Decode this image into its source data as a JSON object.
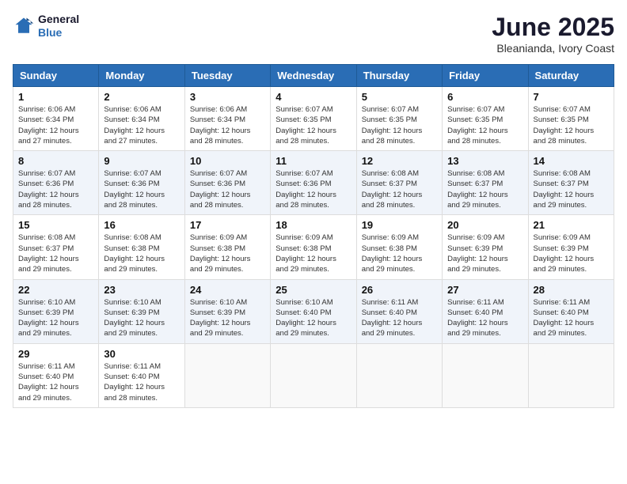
{
  "header": {
    "logo_line1": "General",
    "logo_line2": "Blue",
    "main_title": "June 2025",
    "subtitle": "Bleanianda, Ivory Coast"
  },
  "calendar": {
    "days_of_week": [
      "Sunday",
      "Monday",
      "Tuesday",
      "Wednesday",
      "Thursday",
      "Friday",
      "Saturday"
    ],
    "weeks": [
      [
        null,
        {
          "day": "2",
          "sunrise": "6:06 AM",
          "sunset": "6:34 PM",
          "daylight": "12 hours and 27 minutes."
        },
        {
          "day": "3",
          "sunrise": "6:06 AM",
          "sunset": "6:34 PM",
          "daylight": "12 hours and 28 minutes."
        },
        {
          "day": "4",
          "sunrise": "6:07 AM",
          "sunset": "6:35 PM",
          "daylight": "12 hours and 28 minutes."
        },
        {
          "day": "5",
          "sunrise": "6:07 AM",
          "sunset": "6:35 PM",
          "daylight": "12 hours and 28 minutes."
        },
        {
          "day": "6",
          "sunrise": "6:07 AM",
          "sunset": "6:35 PM",
          "daylight": "12 hours and 28 minutes."
        },
        {
          "day": "7",
          "sunrise": "6:07 AM",
          "sunset": "6:35 PM",
          "daylight": "12 hours and 28 minutes."
        }
      ],
      [
        {
          "day": "1",
          "sunrise": "6:06 AM",
          "sunset": "6:34 PM",
          "daylight": "12 hours and 27 minutes."
        },
        null,
        null,
        null,
        null,
        null,
        null
      ],
      [
        {
          "day": "8",
          "sunrise": "6:07 AM",
          "sunset": "6:36 PM",
          "daylight": "12 hours and 28 minutes."
        },
        {
          "day": "9",
          "sunrise": "6:07 AM",
          "sunset": "6:36 PM",
          "daylight": "12 hours and 28 minutes."
        },
        {
          "day": "10",
          "sunrise": "6:07 AM",
          "sunset": "6:36 PM",
          "daylight": "12 hours and 28 minutes."
        },
        {
          "day": "11",
          "sunrise": "6:07 AM",
          "sunset": "6:36 PM",
          "daylight": "12 hours and 28 minutes."
        },
        {
          "day": "12",
          "sunrise": "6:08 AM",
          "sunset": "6:37 PM",
          "daylight": "12 hours and 28 minutes."
        },
        {
          "day": "13",
          "sunrise": "6:08 AM",
          "sunset": "6:37 PM",
          "daylight": "12 hours and 29 minutes."
        },
        {
          "day": "14",
          "sunrise": "6:08 AM",
          "sunset": "6:37 PM",
          "daylight": "12 hours and 29 minutes."
        }
      ],
      [
        {
          "day": "15",
          "sunrise": "6:08 AM",
          "sunset": "6:37 PM",
          "daylight": "12 hours and 29 minutes."
        },
        {
          "day": "16",
          "sunrise": "6:08 AM",
          "sunset": "6:38 PM",
          "daylight": "12 hours and 29 minutes."
        },
        {
          "day": "17",
          "sunrise": "6:09 AM",
          "sunset": "6:38 PM",
          "daylight": "12 hours and 29 minutes."
        },
        {
          "day": "18",
          "sunrise": "6:09 AM",
          "sunset": "6:38 PM",
          "daylight": "12 hours and 29 minutes."
        },
        {
          "day": "19",
          "sunrise": "6:09 AM",
          "sunset": "6:38 PM",
          "daylight": "12 hours and 29 minutes."
        },
        {
          "day": "20",
          "sunrise": "6:09 AM",
          "sunset": "6:39 PM",
          "daylight": "12 hours and 29 minutes."
        },
        {
          "day": "21",
          "sunrise": "6:09 AM",
          "sunset": "6:39 PM",
          "daylight": "12 hours and 29 minutes."
        }
      ],
      [
        {
          "day": "22",
          "sunrise": "6:10 AM",
          "sunset": "6:39 PM",
          "daylight": "12 hours and 29 minutes."
        },
        {
          "day": "23",
          "sunrise": "6:10 AM",
          "sunset": "6:39 PM",
          "daylight": "12 hours and 29 minutes."
        },
        {
          "day": "24",
          "sunrise": "6:10 AM",
          "sunset": "6:39 PM",
          "daylight": "12 hours and 29 minutes."
        },
        {
          "day": "25",
          "sunrise": "6:10 AM",
          "sunset": "6:40 PM",
          "daylight": "12 hours and 29 minutes."
        },
        {
          "day": "26",
          "sunrise": "6:11 AM",
          "sunset": "6:40 PM",
          "daylight": "12 hours and 29 minutes."
        },
        {
          "day": "27",
          "sunrise": "6:11 AM",
          "sunset": "6:40 PM",
          "daylight": "12 hours and 29 minutes."
        },
        {
          "day": "28",
          "sunrise": "6:11 AM",
          "sunset": "6:40 PM",
          "daylight": "12 hours and 29 minutes."
        }
      ],
      [
        {
          "day": "29",
          "sunrise": "6:11 AM",
          "sunset": "6:40 PM",
          "daylight": "12 hours and 29 minutes."
        },
        {
          "day": "30",
          "sunrise": "6:11 AM",
          "sunset": "6:40 PM",
          "daylight": "12 hours and 28 minutes."
        },
        null,
        null,
        null,
        null,
        null
      ]
    ]
  }
}
